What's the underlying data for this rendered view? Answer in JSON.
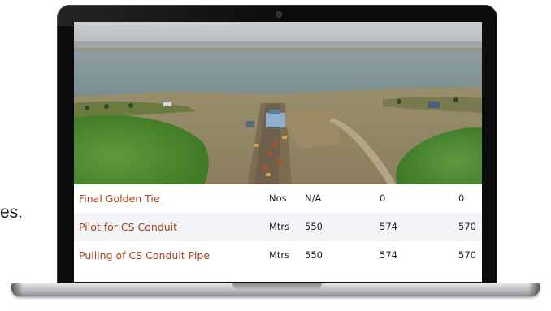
{
  "side_text": "es.",
  "colors": {
    "link": "#a5421a",
    "row_alt": "#f2f4f8",
    "bezel": "#0c0c0c"
  },
  "table": {
    "rows": [
      {
        "name": "Final Golden Tie",
        "unit": "Nos",
        "a": "N/A",
        "b": "0",
        "c": "0"
      },
      {
        "name": "Pilot for CS Conduit",
        "unit": "Mtrs",
        "a": "550",
        "b": "574",
        "c": "570"
      },
      {
        "name": "Pulling of CS Conduit Pipe",
        "unit": "Mtrs",
        "a": "550",
        "b": "574",
        "c": "570"
      }
    ]
  }
}
